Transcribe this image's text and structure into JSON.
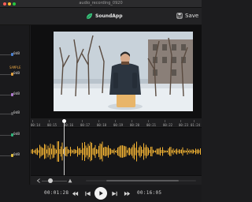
{
  "window": {
    "title": "audio_recording_0920"
  },
  "header": {
    "app_name": "SoundApp",
    "save_label": "Save"
  },
  "sidebar": {
    "items": [
      {
        "value": "0dB",
        "color": "#4a7fd0",
        "tag": ""
      },
      {
        "value": "0dB",
        "color": "#e0a040",
        "tag": "SAMPLE"
      },
      {
        "value": "0dB",
        "color": "#b07ad0",
        "tag": ""
      },
      {
        "value": "0dB",
        "color": "#5a5a5c",
        "tag": ""
      },
      {
        "value": "0dB",
        "color": "#2fb37a",
        "tag": ""
      },
      {
        "value": "0dB",
        "color": "#e0c040",
        "tag": ""
      }
    ]
  },
  "timeline": {
    "ticks": [
      "00:14",
      "00:15",
      "00:16",
      "00:17",
      "00:18",
      "00:19",
      "00:20",
      "00:21",
      "00:22",
      "00:23",
      "01:24"
    ],
    "waveform_color": "#f2b233"
  },
  "transport": {
    "current_time": "00:01:28",
    "total_time": "00:16:05"
  },
  "icons": {
    "brand": "leaf-icon",
    "save": "save-icon",
    "zoom_out": "zoom-out-icon",
    "zoom_in": "zoom-in-icon",
    "rewind": "rewind-icon",
    "prev": "skip-back-icon",
    "play": "play-icon",
    "next": "skip-forward-icon",
    "forward": "fast-forward-icon"
  }
}
